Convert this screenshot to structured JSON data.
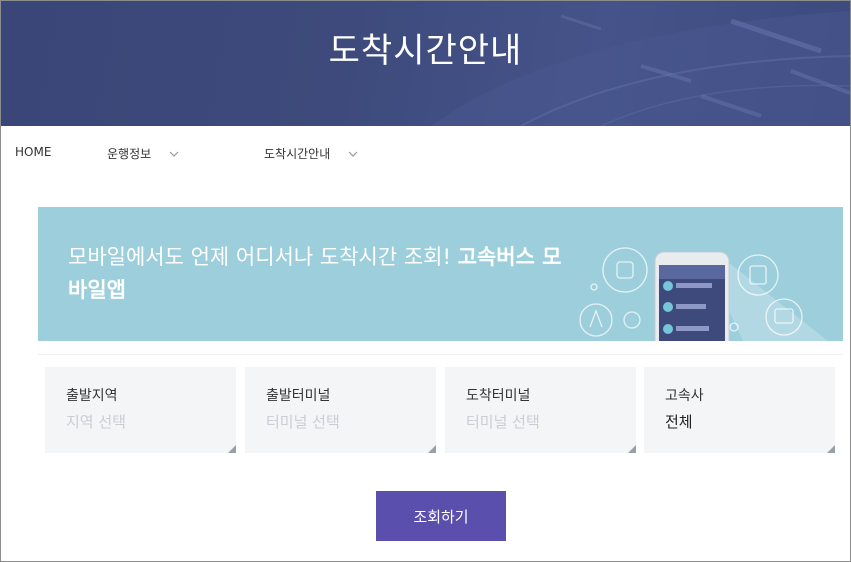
{
  "header": {
    "title": "도착시간안내",
    "bg_color": "#3d4a7b"
  },
  "breadcrumb": {
    "home": "HOME",
    "level1": "운행정보",
    "level2": "도착시간안내"
  },
  "banner": {
    "text_regular": "모바일에서도 언제 어디서나 도착시간 조회! ",
    "text_bold": "고속버스 모바일앱",
    "bg_color": "#9ccedc"
  },
  "fields": [
    {
      "label": "출발지역",
      "value": "지역 선택",
      "selected": false
    },
    {
      "label": "출발터미널",
      "value": "터미널 선택",
      "selected": false
    },
    {
      "label": "도착터미널",
      "value": "터미널 선택",
      "selected": false
    },
    {
      "label": "고속사",
      "value": "전체",
      "selected": true
    }
  ],
  "search_button": {
    "label": "조회하기",
    "color": "#5a4fad"
  }
}
